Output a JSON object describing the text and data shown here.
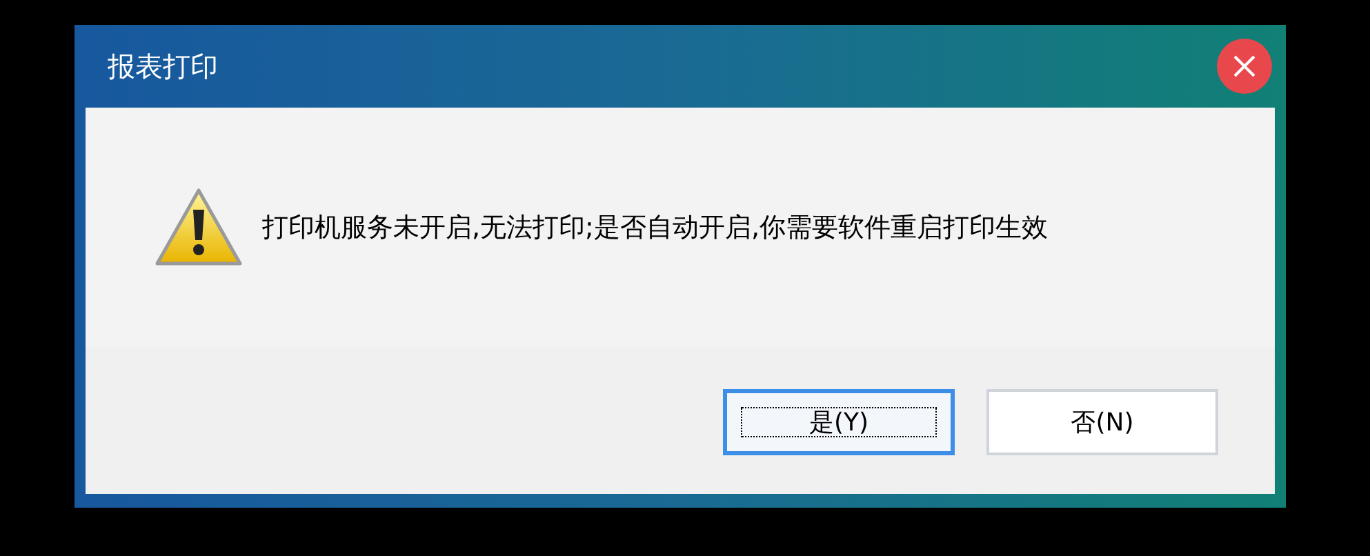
{
  "window": {
    "title": "报表打印"
  },
  "message": {
    "kind": "warning",
    "text": "打印机服务未开启,无法打印;是否自动开启,你需要软件重启打印生效"
  },
  "buttons": [
    {
      "label": "是(Y)",
      "selected": true
    },
    {
      "label": "否(N)",
      "selected": false
    }
  ]
}
